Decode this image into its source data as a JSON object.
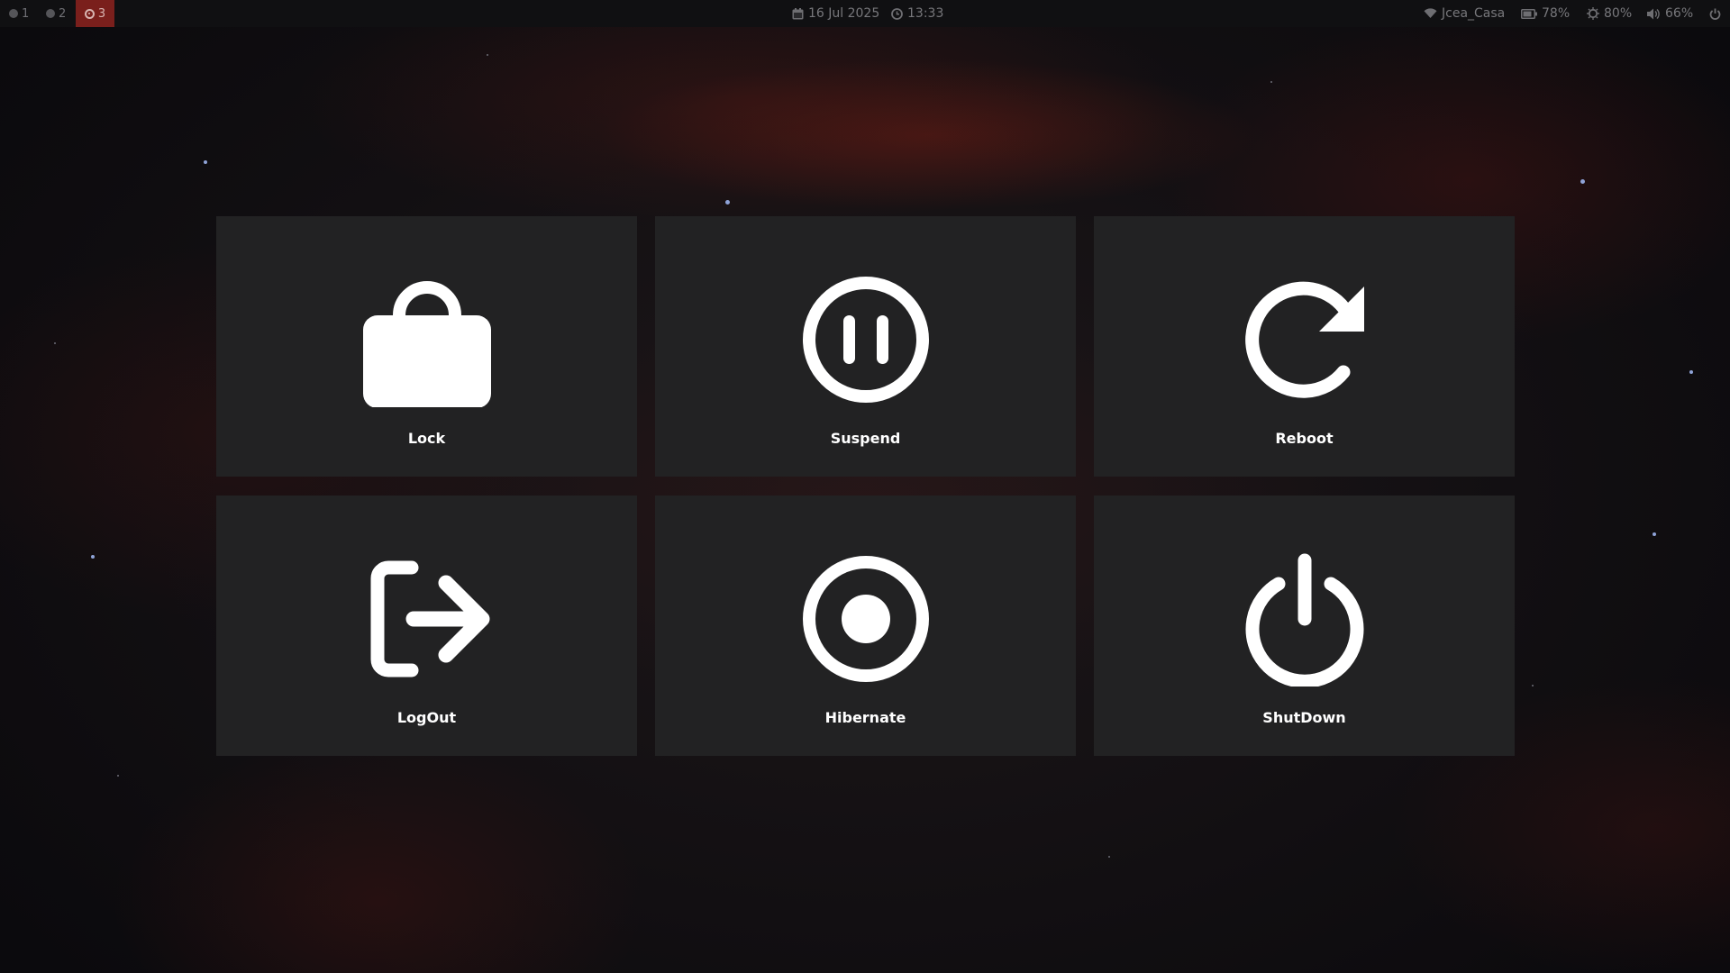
{
  "topbar": {
    "workspaces": [
      {
        "label": "1",
        "active": false
      },
      {
        "label": "2",
        "active": false
      },
      {
        "label": "3",
        "active": true
      }
    ],
    "date": "16 Jul 2025",
    "time": "13:33",
    "wifi": "Jcea_Casa",
    "battery": "78%",
    "brightness": "80%",
    "volume": "66%",
    "accent_color": "#7a1f1c"
  },
  "menu": {
    "tiles": [
      {
        "label": "Lock",
        "icon": "lock-icon"
      },
      {
        "label": "Suspend",
        "icon": "pause-circle-icon"
      },
      {
        "label": "Reboot",
        "icon": "reboot-icon"
      },
      {
        "label": "LogOut",
        "icon": "logout-icon"
      },
      {
        "label": "Hibernate",
        "icon": "record-circle-icon"
      },
      {
        "label": "ShutDown",
        "icon": "power-icon"
      }
    ],
    "tile_color": "#222223",
    "text_color": "#ffffff"
  }
}
